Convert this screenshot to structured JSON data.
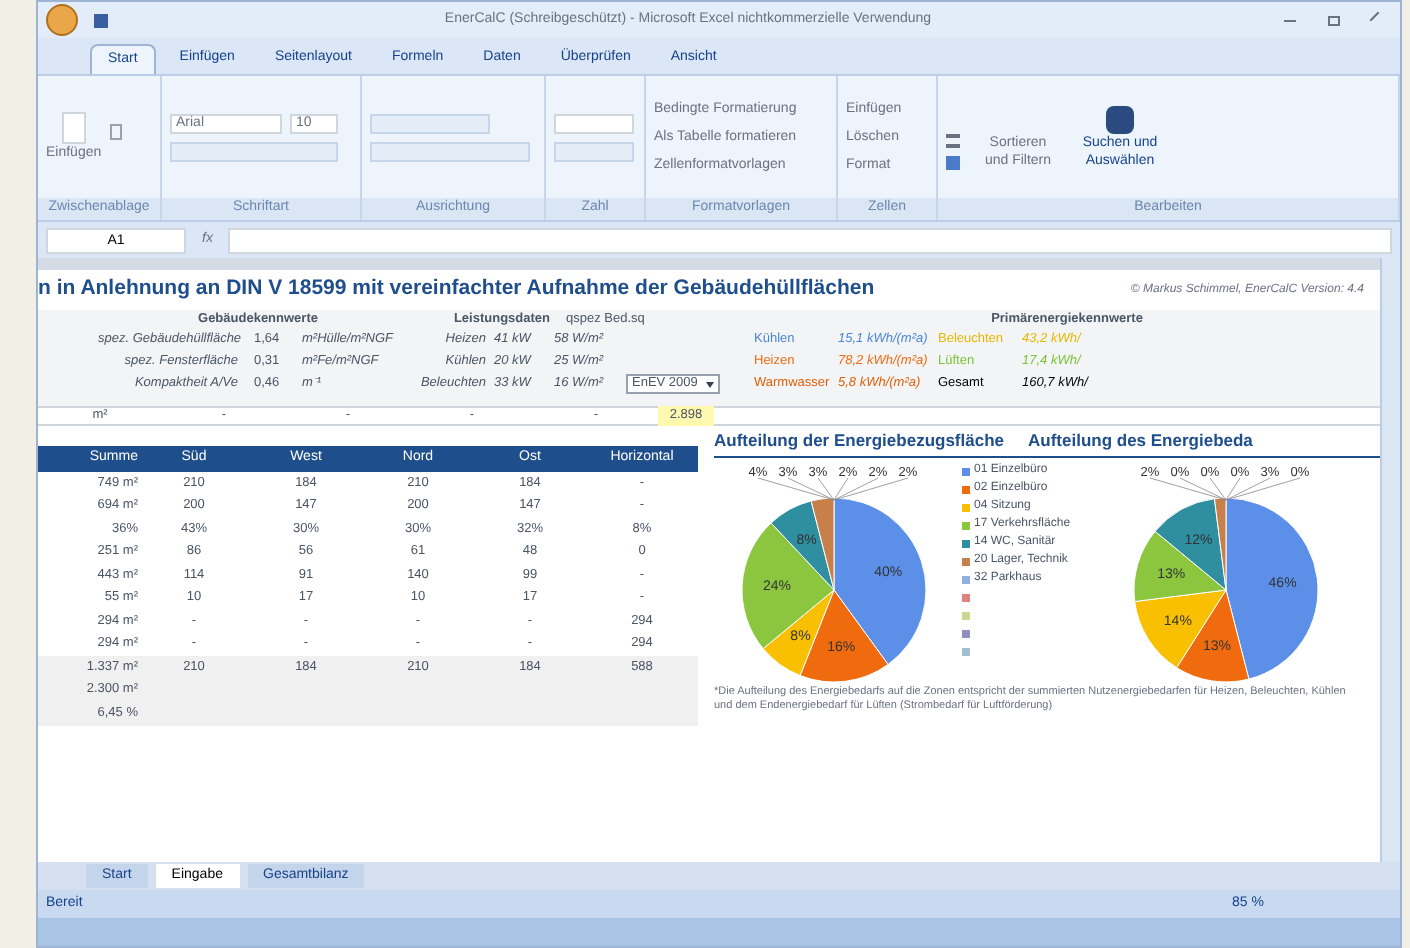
{
  "window": {
    "title": "EnerCalC (Schreibgeschützt) - Microsoft Excel nichtkommerzielle Verwendung"
  },
  "ribbon_tabs": [
    {
      "label": "Start",
      "selected": true
    },
    {
      "label": "Einfügen",
      "selected": false
    },
    {
      "label": "Seitenlayout",
      "selected": false
    },
    {
      "label": "Formeln",
      "selected": false
    },
    {
      "label": "Daten",
      "selected": false
    },
    {
      "label": "Überprüfen",
      "selected": false
    },
    {
      "label": "Ansicht",
      "selected": false
    }
  ],
  "ribbon": {
    "paste": "Einfügen",
    "font": "Arial",
    "size": "10",
    "styles": [
      "Bedingte Formatierung",
      "Als Tabelle formatieren",
      "Zellenformatvorlagen"
    ],
    "cells": [
      "Einfügen",
      "Löschen",
      "Format"
    ],
    "sort": "Sortieren und Filtern",
    "find": "Suchen und Auswählen",
    "groups": [
      "Zwischenablage",
      "Schriftart",
      "Ausrichtung",
      "Zahl",
      "Formatvorlagen",
      "Zellen",
      "Bearbeiten"
    ]
  },
  "formula_bar": {
    "name_box": "A1",
    "fx": "fx"
  },
  "sheet": {
    "title": "n in Anlehnung an DIN V 18599 mit vereinfachter Aufnahme der Gebäudehüllflächen",
    "copyright": "© Markus Schimmel, EnerCalC Version: 4.4",
    "building_header": "Gebäudekennwerte",
    "building": [
      {
        "label": "spez. Gebäudehüllfläche",
        "value": "1,64",
        "unit": "m²Hülle/m²NGF"
      },
      {
        "label": "spez. Fensterfläche",
        "value": "0,31",
        "unit": "m²Fe/m²NGF"
      },
      {
        "label": "Kompaktheit A/Ve",
        "value": "0,46",
        "unit": "m⁻¹"
      }
    ],
    "power_header": "Leistungsdaten",
    "spec_header": "qspez Bed.sq",
    "power": [
      {
        "label": "Heizen",
        "value": "41 kW",
        "spec": "58 W/m²"
      },
      {
        "label": "Kühlen",
        "value": "20 kW",
        "spec": "25 W/m²"
      },
      {
        "label": "Beleuchten",
        "value": "33 kW",
        "spec": "16 W/m²"
      }
    ],
    "standard": "EnEV 2009",
    "primary_header": "Primärenergiekennwerte",
    "primary": [
      {
        "items": [
          {
            "label": "Kühlen",
            "value": "15,1 kWh/(m²a)",
            "color": "#4a86d8"
          },
          {
            "label": "Beleuchten",
            "value": "43,2 kWh/",
            "color": "#e8b800"
          }
        ]
      },
      {
        "items": [
          {
            "label": "Heizen",
            "value": "78,2 kWh/(m²a)",
            "color": "#f06a0e"
          },
          {
            "label": "Lüften",
            "value": "17,4 kWh/",
            "color": "#7cc23a"
          }
        ]
      },
      {
        "items": [
          {
            "label": "Warmwasser",
            "value": "5,8 kWh/(m²a)",
            "color": "#e0600a"
          },
          {
            "label": "Gesamt",
            "value": "160,7 kWh/",
            "color": "#000000"
          }
        ]
      }
    ],
    "sum_row": [
      "m²",
      "-",
      "-",
      "-",
      "-",
      "2.898"
    ]
  },
  "table": {
    "columns": [
      "Summe",
      "Süd",
      "West",
      "Nord",
      "Ost",
      "Horizontal"
    ],
    "rows": [
      [
        "749 m²",
        "210",
        "184",
        "210",
        "184",
        "-"
      ],
      [
        "694 m²",
        "200",
        "147",
        "200",
        "147",
        "-"
      ],
      [
        "36%",
        "43%",
        "30%",
        "30%",
        "32%",
        "8%"
      ],
      [
        "251 m²",
        "86",
        "56",
        "61",
        "48",
        "0"
      ],
      [
        "443 m²",
        "114",
        "91",
        "140",
        "99",
        "-"
      ],
      [
        "55 m²",
        "10",
        "17",
        "10",
        "17",
        "-"
      ],
      [
        "294 m²",
        "-",
        "-",
        "-",
        "-",
        "294"
      ],
      [
        "294 m²",
        "-",
        "-",
        "-",
        "-",
        "294"
      ],
      [
        "1.337 m²",
        "210",
        "184",
        "210",
        "184",
        "588"
      ],
      [
        "2.300 m²"
      ],
      [
        "6,45 %"
      ]
    ]
  },
  "legend": [
    {
      "label": "01 Einzelbüro",
      "color": "#5b8fe8"
    },
    {
      "label": "02 Einzelbüro",
      "color": "#f06a0e"
    },
    {
      "label": "04 Sitzung",
      "color": "#f8c000"
    },
    {
      "label": "17 Verkehrsfläche",
      "color": "#8cc63f"
    },
    {
      "label": "14 WC, Sanitär",
      "color": "#2f8fa0"
    },
    {
      "label": "20 Lager, Technik",
      "color": "#c8804a"
    },
    {
      "label": "32 Parkhaus",
      "color": "#8fb0e0"
    },
    {
      "color": "#e08080"
    },
    {
      "color": "#c8d890"
    },
    {
      "color": "#9090c0"
    },
    {
      "color": "#a0c0d0"
    }
  ],
  "charts": [
    {
      "outer_labels": [
        "4%",
        "3%",
        "3%",
        "2%",
        "2%",
        "2%"
      ],
      "chart_data": {
        "type": "pie",
        "title": "Aufteilung der Energiebezugsfläche",
        "values": [
          40,
          16,
          8,
          24,
          8,
          4
        ],
        "value_labels": [
          "40%",
          "16%",
          "8%",
          "24%",
          "8%",
          null
        ]
      }
    },
    {
      "outer_labels": [
        "2%",
        "0%",
        "0%",
        "0%",
        "3%",
        "0%"
      ],
      "chart_data": {
        "type": "pie",
        "title": "Aufteilung des Energiebeda",
        "values": [
          46,
          13,
          14,
          13,
          12,
          2
        ],
        "value_labels": [
          "46%",
          "13%",
          "14%",
          "13%",
          "12%",
          null
        ]
      }
    }
  ],
  "footnote": "*Die Aufteilung des Energiebedarfs auf die Zonen entspricht der summierten Nutzenergiebedarfen für Heizen, Beleuchten, Kühlen und dem Endenergiebedarf für Lüften (Strombedarf für Luftförderung)",
  "sheet_tabs": [
    {
      "label": "Start",
      "selected": false
    },
    {
      "label": "Eingabe",
      "selected": true
    },
    {
      "label": "Gesamtbilanz",
      "selected": false
    }
  ],
  "status": {
    "text": "Bereit",
    "zoom": "85 %"
  }
}
